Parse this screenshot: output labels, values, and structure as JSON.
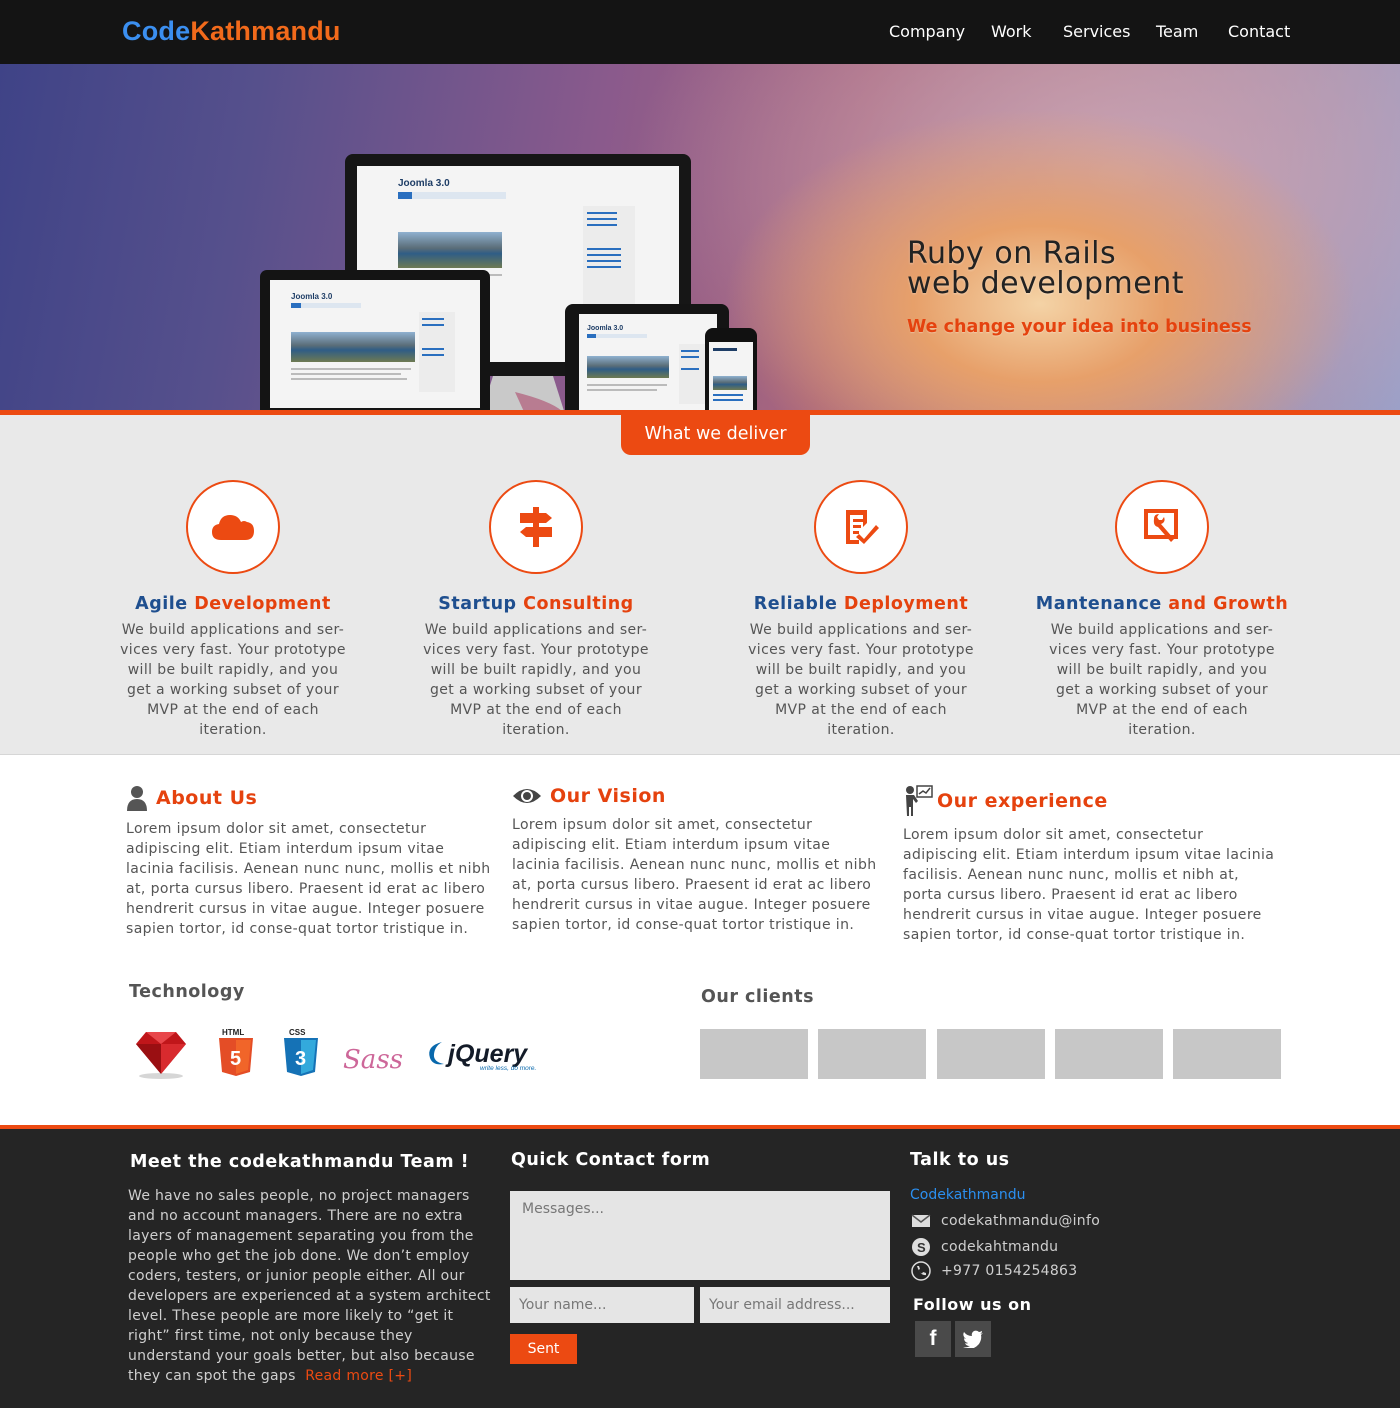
{
  "brand": {
    "part1": "Code",
    "part2": "Kathmandu"
  },
  "nav": {
    "items": [
      "Company",
      "Work",
      "Services",
      "Team",
      "Contact"
    ]
  },
  "hero": {
    "title_line1": "Ruby on Rails",
    "title_line2": "web development",
    "subtitle": "We change your idea into business",
    "device_screen_title": "Joomla 3.0"
  },
  "deliver": {
    "tab_label": "What we deliver",
    "services": [
      {
        "title_a": "Agile",
        "title_b": "Development",
        "icon": "cloud-icon",
        "text": "We build applications and ser-vices very fast. Your prototype will be built rapidly, and you get a working subset of your MVP at the end of each iteration."
      },
      {
        "title_a": "Startup",
        "title_b": "Consulting",
        "icon": "signpost-icon",
        "text": "We build applications and ser-vices very fast. Your prototype will be built rapidly, and you get a working subset of your MVP at the end of each iteration."
      },
      {
        "title_a": "Reliable",
        "title_b": "Deployment",
        "icon": "checklist-icon",
        "text": "We build applications and ser-vices very fast. Your prototype will be built rapidly, and you get a working subset of your MVP at the end of each iteration."
      },
      {
        "title_a": "Mantenance",
        "title_b": "and Growth",
        "icon": "wrench-icon",
        "text": "We build applications and ser-vices very fast. Your prototype will be built rapidly, and you get a working subset of your MVP at the end of each iteration."
      }
    ]
  },
  "about": [
    {
      "title": "About Us",
      "icon": "user-icon",
      "text": "Lorem ipsum dolor sit amet, consectetur adipiscing elit. Etiam interdum ipsum vitae lacinia facilisis. Aenean nunc nunc, mollis et nibh at, porta cursus libero. Praesent id erat ac libero hendrerit cursus in vitae augue. Integer posuere sapien tortor, id conse-quat tortor tristique in."
    },
    {
      "title": "Our Vision",
      "icon": "eye-icon",
      "text": "Lorem ipsum dolor sit amet, consectetur adipiscing elit. Etiam interdum ipsum vitae lacinia facilisis. Aenean nunc nunc, mollis et nibh at, porta cursus libero. Praesent id erat ac libero hendrerit cursus in vitae augue. Integer posuere sapien tortor, id conse-quat tortor tristique in."
    },
    {
      "title": "Our experience",
      "icon": "presenter-icon",
      "text": "Lorem ipsum dolor sit amet, consectetur adipiscing elit. Etiam interdum ipsum vitae lacinia facilisis. Aenean nunc nunc, mollis et nibh at, porta cursus libero. Praesent id erat ac libero hendrerit cursus in vitae augue. Integer posuere sapien tortor, id conse-quat tortor tristique in."
    }
  ],
  "technology": {
    "title": "Technology",
    "logos": {
      "html": "HTML",
      "css": "CSS",
      "sass": "Sass",
      "jquery": "jQuery",
      "jquery_tag": "write less, do more."
    }
  },
  "clients": {
    "title": "Our clients",
    "count": 5
  },
  "footer": {
    "team_title": "Meet the codekathmandu Team !",
    "team_text": "We have no sales people, no project managers and no account managers. There are no extra layers of management separating you from the people who get the job done. We don’t employ coders, testers, or junior people either. All our developers are experienced at a system architect level. These people are more likely to “get it right” first time, not only because they understand your goals better, but also because they can spot the gaps",
    "read_more": "Read more [+]",
    "form_title": "Quick Contact form",
    "message_placeholder": "Messages...",
    "name_placeholder": "Your name...",
    "email_placeholder": "Your email address...",
    "submit_label": "Sent",
    "talk_title": "Talk to us",
    "company": "Codekathmandu",
    "email": "codekathmandu@info",
    "skype": "codekahtmandu",
    "phone": "+977 0154254863",
    "follow_title": "Follow us on",
    "social": {
      "facebook": "f",
      "twitter": "twitter-icon"
    }
  },
  "colors": {
    "accent": "#ec4a12",
    "brand_blue": "#3b8ff0",
    "heading_blue": "#1f4f8f",
    "footer_bg": "#252525"
  }
}
